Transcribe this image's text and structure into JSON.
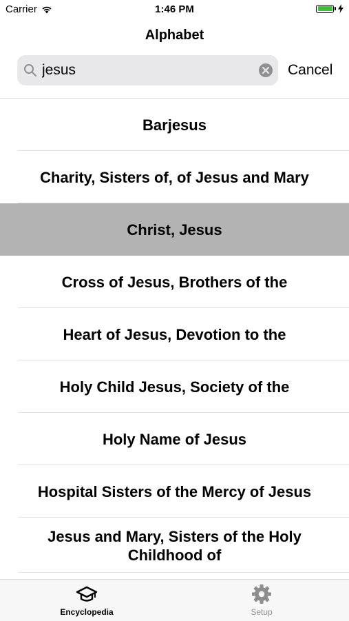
{
  "status_bar": {
    "carrier": "Carrier",
    "time": "1:46 PM",
    "battery_color": "#3ec23e"
  },
  "nav": {
    "title": "Alphabet"
  },
  "search": {
    "value": "jesus",
    "cancel_label": "Cancel"
  },
  "results": [
    {
      "label": "Barjesus",
      "selected": false
    },
    {
      "label": "Charity, Sisters of, of Jesus and Mary",
      "selected": false
    },
    {
      "label": "Christ, Jesus",
      "selected": true
    },
    {
      "label": "Cross of Jesus, Brothers of the",
      "selected": false
    },
    {
      "label": "Heart of Jesus, Devotion to the",
      "selected": false
    },
    {
      "label": "Holy Child Jesus, Society of the",
      "selected": false
    },
    {
      "label": "Holy Name of Jesus",
      "selected": false
    },
    {
      "label": "Hospital Sisters of the Mercy of Jesus",
      "selected": false
    },
    {
      "label": "Jesus and Mary, Sisters of the Holy Childhood of",
      "selected": false
    }
  ],
  "tabs": {
    "encyclopedia": {
      "label": "Encyclopedia",
      "icon": "graduation-cap-icon",
      "active": true
    },
    "setup": {
      "label": "Setup",
      "icon": "gear-icon",
      "active": false
    }
  },
  "colors": {
    "selected_row": "#b3b3b3",
    "inactive_tab": "#8e8e8e"
  }
}
